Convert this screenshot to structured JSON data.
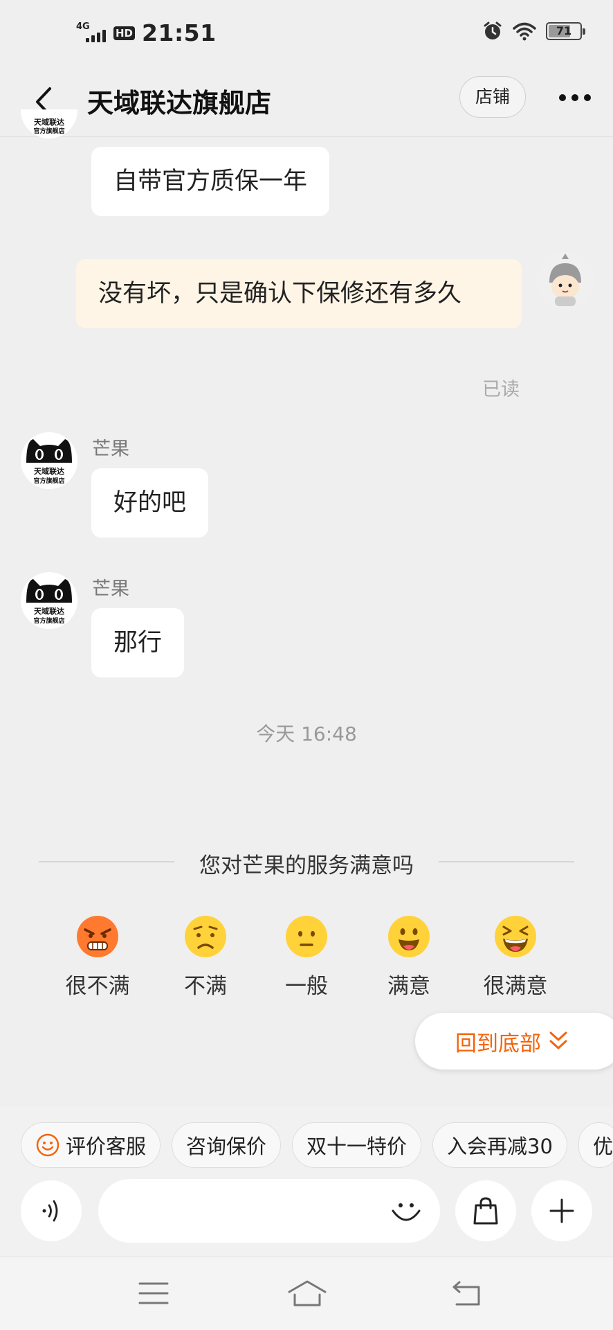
{
  "status_bar": {
    "network": "4G",
    "hd": "HD",
    "time": "21:51",
    "battery": "71",
    "battery_level": 0.71
  },
  "header": {
    "title": "天域联达旗舰店",
    "store_button": "店铺",
    "back_icon": "back-arrow-icon",
    "more_icon": "more-dots-icon"
  },
  "shop_badge": {
    "line1": "天域联达",
    "line2": "官方旗舰店"
  },
  "messages": [
    {
      "from": "shop",
      "text": "自带官方质保一年"
    },
    {
      "from": "me",
      "text": "没有坏，只是确认下保修还有多久",
      "status": "已读"
    },
    {
      "from": "shop",
      "sender": "芒果",
      "text": "好的吧"
    },
    {
      "from": "shop",
      "sender": "芒果",
      "text": "那行"
    }
  ],
  "timestamp": "今天  16:48",
  "rating": {
    "title": "您对芒果的服务满意吗",
    "options": [
      {
        "label": "很不满",
        "icon": "angry-face-icon"
      },
      {
        "label": "不满",
        "icon": "frown-face-icon"
      },
      {
        "label": "一般",
        "icon": "neutral-face-icon"
      },
      {
        "label": "满意",
        "icon": "smile-face-icon"
      },
      {
        "label": "很满意",
        "icon": "laughing-face-icon"
      }
    ]
  },
  "scroll_to_bottom": "回到底部",
  "quick_replies": [
    "评价客服",
    "咨询保价",
    "双十一特价",
    "入会再减30",
    "优"
  ],
  "input": {
    "placeholder": "",
    "voice_icon": "voice-icon",
    "emoji_icon": "emoji-icon",
    "bag_icon": "shopping-bag-icon",
    "plus_icon": "plus-icon"
  },
  "nav": {
    "menu_icon": "menu-icon",
    "home_icon": "home-icon",
    "back_icon": "return-icon"
  },
  "colors": {
    "background": "#efefef",
    "my_bubble": "#fef5e6",
    "accent": "#f5640a"
  }
}
